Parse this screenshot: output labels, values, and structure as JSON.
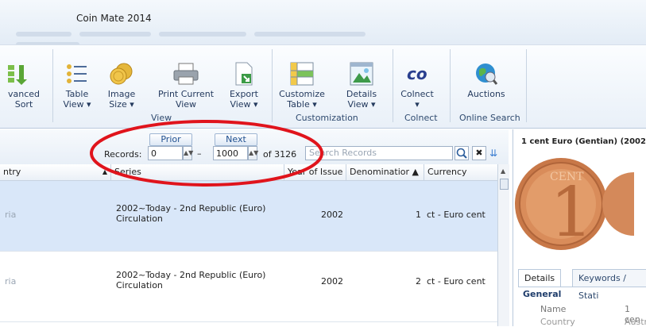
{
  "app": {
    "title": "Coin Mate 2014"
  },
  "ribbon": {
    "buttons": {
      "advanced_sort": {
        "line1": "vanced",
        "line2": "Sort"
      },
      "table_view": {
        "line1": "Table",
        "line2": "View ▾"
      },
      "image_size": {
        "line1": "Image",
        "line2": "Size ▾"
      },
      "print_current": {
        "line1": "Print Current",
        "line2": "View"
      },
      "export_view": {
        "line1": "Export",
        "line2": "View ▾"
      },
      "customize_table": {
        "line1": "Customize",
        "line2": "Table ▾"
      },
      "details_view": {
        "line1": "Details",
        "line2": "View ▾"
      },
      "colnect": {
        "line1": "Colnect",
        "line2": "▾"
      },
      "auctions": {
        "line1": "Auctions",
        "line2": ""
      }
    },
    "groups": {
      "view": "View",
      "customization": "Customization",
      "colnect": "Colnect",
      "online_search": "Online Search"
    }
  },
  "nav": {
    "prior_label": "Prior",
    "next_label": "Next",
    "records_label": "Records:",
    "from_value": "0",
    "dash": "–",
    "to_value": "1000",
    "of_text": "of 3126",
    "search_placeholder": "Search Records"
  },
  "table": {
    "columns": {
      "country": "ntry",
      "series": "Series",
      "year": "Year of Issue",
      "denomination": "Denominatior ▲",
      "currency": "Currency"
    },
    "rows": [
      {
        "country": "ria",
        "series_line1": "2002~Today - 2nd Republic (Euro)",
        "series_line2": "Circulation",
        "year": "2002",
        "denomination": "1",
        "currency": "ct - Euro cent"
      },
      {
        "country": "ria",
        "series_line1": "2002~Today - 2nd Republic (Euro)",
        "series_line2": "Circulation",
        "year": "2002",
        "denomination": "2",
        "currency": "ct - Euro cent"
      }
    ]
  },
  "detail": {
    "title": "1 cent Euro (Gentian)  (2002",
    "coin_text": "CENT",
    "tabs": {
      "details": "Details",
      "keywords": "Keywords / Stati"
    },
    "section": "General",
    "fields": [
      {
        "label": "Name",
        "value": "1 cen"
      },
      {
        "label": "Country",
        "value": "Austr"
      }
    ]
  },
  "colors": {
    "highlight_row": "#d9e7f9",
    "annotation": "#e0141c",
    "accent": "#1f5fa8"
  }
}
